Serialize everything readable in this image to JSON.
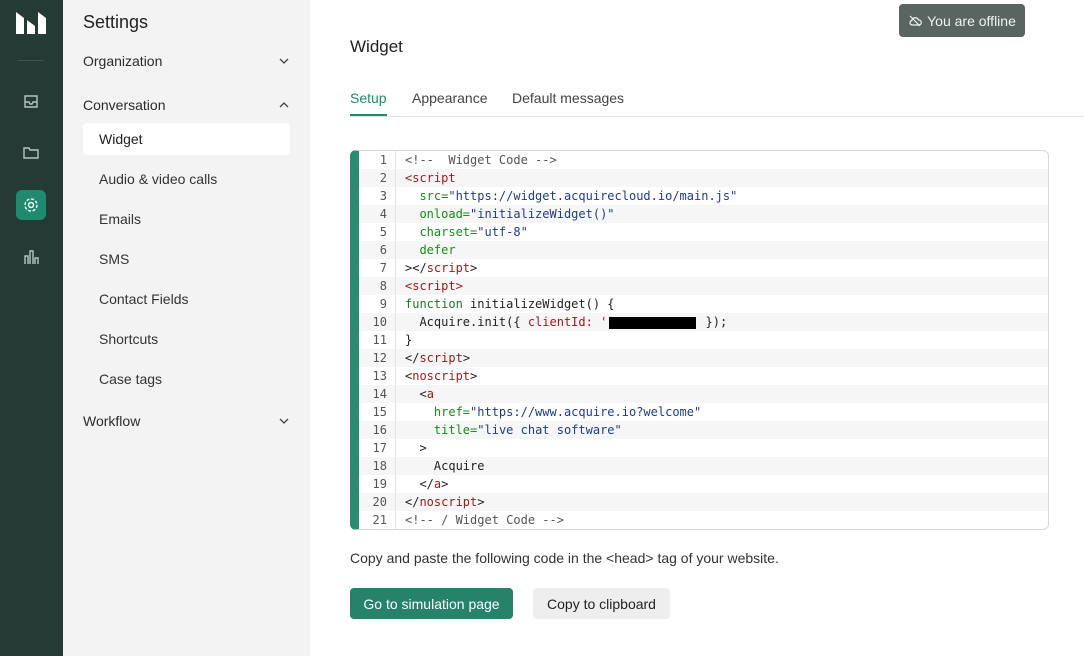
{
  "sidebar": {
    "title": "Settings",
    "sections": [
      {
        "label": "Organization",
        "expanded": false
      },
      {
        "label": "Conversation",
        "expanded": true
      },
      {
        "label": "Workflow",
        "expanded": false
      }
    ],
    "conversation_items": [
      {
        "label": "Widget",
        "active": true
      },
      {
        "label": "Audio & video calls"
      },
      {
        "label": "Emails"
      },
      {
        "label": "SMS"
      },
      {
        "label": "Contact Fields"
      },
      {
        "label": "Shortcuts"
      },
      {
        "label": "Case tags"
      }
    ]
  },
  "rail": {
    "icons": [
      "inbox-icon",
      "folder-icon",
      "gear-icon",
      "bar-chart-icon"
    ],
    "active": "gear-icon",
    "active_color": "#1f8a6f",
    "background": "#263a35"
  },
  "header": {
    "title": "Widget",
    "offline_badge": "You are offline"
  },
  "tabs": [
    {
      "label": "Setup",
      "active": true
    },
    {
      "label": "Appearance"
    },
    {
      "label": "Default messages"
    }
  ],
  "code": {
    "line_numbers": [
      "1",
      "2",
      "3",
      "4",
      "5",
      "6",
      "7",
      "8",
      "9",
      "10",
      "11",
      "12",
      "13",
      "14",
      "15",
      "16",
      "17",
      "18",
      "19",
      "20",
      "21"
    ],
    "tokens": {
      "l1": "<!--  Widget Code -->",
      "l2_tag": "<script",
      "l3_attr": "src=",
      "l3_val": "\"https://widget.acquirecloud.io/main.js\"",
      "l4_attr": "onload=",
      "l4_val": "\"initializeWidget()\"",
      "l5_attr": "charset=",
      "l5_val": "\"utf-8\"",
      "l6_attr": "defer",
      "l7_a": "></",
      "l7_b": "script",
      "l7_c": ">",
      "l8": "<script>",
      "l9_kw": "function",
      "l9_rest": " initializeWidget() {",
      "l10_a": "Acquire.init({ ",
      "l10_b": "clientId: '",
      "l10_c": " });",
      "l11": "}",
      "l12_a": "</",
      "l12_b": "script",
      "l12_c": ">",
      "l13_a": "<",
      "l13_b": "noscript",
      "l13_c": ">",
      "l14_a": "<",
      "l14_b": "a",
      "l15_attr": "href=",
      "l15_val": "\"https://www.acquire.io?welcome\"",
      "l16_attr": "title=",
      "l16_val": "\"live chat software\"",
      "l17": ">",
      "l18": "Acquire",
      "l19_a": "</",
      "l19_b": "a",
      "l19_c": ">",
      "l20_a": "</",
      "l20_b": "noscript",
      "l20_c": ">",
      "l21": "<!-- / Widget Code -->"
    }
  },
  "hint": "Copy and paste the following code in the <head> tag of your website.",
  "buttons": {
    "simulation": "Go to simulation page",
    "copy": "Copy to clipboard"
  },
  "colors": {
    "accent": "#1f8a6f",
    "primary_button": "#27826a",
    "code_border": "#2b8a70"
  }
}
